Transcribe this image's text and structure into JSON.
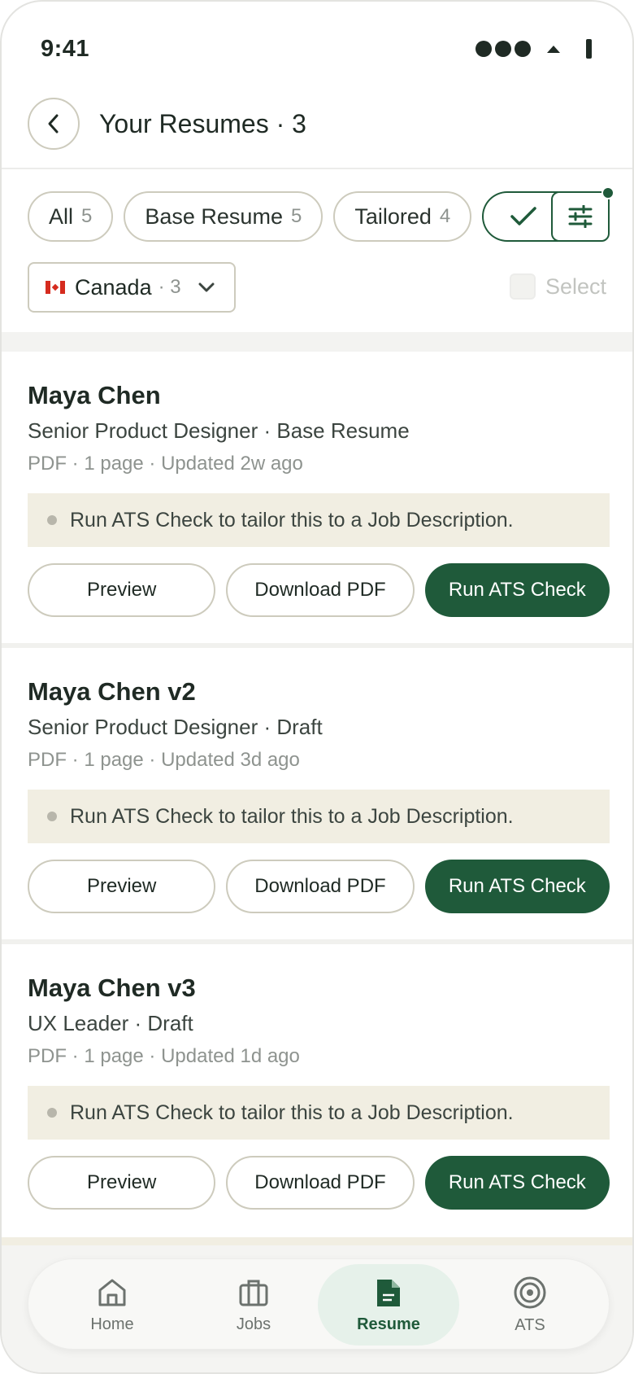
{
  "status_bar": {
    "time": "9:41"
  },
  "header": {
    "title": "Your Resumes · 3"
  },
  "filters": [
    {
      "label": "All",
      "count": "5"
    },
    {
      "label": "Base Resume",
      "count": "5"
    },
    {
      "label": "Tailored",
      "count": "4"
    }
  ],
  "country_filter": {
    "label": "Canada",
    "count": "· 3",
    "flag": "canada-flag-icon"
  },
  "select_label": "Select",
  "colors": {
    "accent": "#1f5a3a",
    "tip_bg": "#f1eee2",
    "border": "#cdcbbd"
  },
  "resumes": [
    {
      "name": "Maya Chen",
      "role": "Senior Product Designer · Base Resume",
      "meta": "PDF · 1 page · Updated 2w ago",
      "tip": "Run ATS Check to tailor this to a Job Description.",
      "preview_label": "Preview",
      "download_label": "Download PDF",
      "ats_label": "Run ATS Check"
    },
    {
      "name": "Maya Chen v2",
      "role": "Senior Product Designer · Draft",
      "meta": "PDF · 1 page · Updated 3d ago",
      "tip": "Run ATS Check to tailor this to a Job Description.",
      "preview_label": "Preview",
      "download_label": "Download PDF",
      "ats_label": "Run ATS Check"
    },
    {
      "name": "Maya Chen v3",
      "role": "UX Leader · Draft",
      "meta": "PDF · 1 page · Updated 1d ago",
      "tip": "Run ATS Check to tailor this to a Job Description.",
      "preview_label": "Preview",
      "download_label": "Download PDF",
      "ats_label": "Run ATS Check"
    }
  ],
  "nav": [
    {
      "label": "Home",
      "icon": "home-icon"
    },
    {
      "label": "Jobs",
      "icon": "briefcase-icon"
    },
    {
      "label": "Resume",
      "icon": "document-icon",
      "active": true
    },
    {
      "label": "ATS",
      "icon": "target-icon"
    }
  ]
}
